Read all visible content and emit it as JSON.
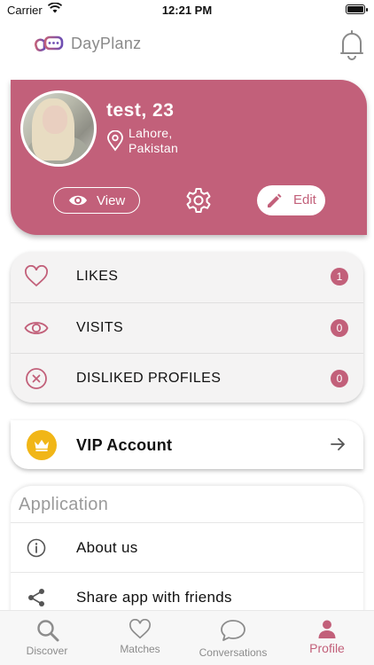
{
  "status_bar": {
    "carrier": "Carrier",
    "time": "12:21 PM"
  },
  "header": {
    "app_name": "DayPlanz",
    "logo_icon": "dayplanz-logo",
    "bell_icon": "bell-icon"
  },
  "profile": {
    "name_age": "test, 23",
    "location_line1": "Lahore,",
    "location_line2": "Pakistan",
    "view_label": "View",
    "edit_label": "Edit"
  },
  "stats": [
    {
      "label": "LIKES",
      "count": "1",
      "icon": "heart-icon"
    },
    {
      "label": "VISITS",
      "count": "0",
      "icon": "eye-icon"
    },
    {
      "label": "DISLIKED PROFILES",
      "count": "0",
      "icon": "close-circle-icon"
    }
  ],
  "vip": {
    "label": "VIP Account",
    "icon": "crown-icon"
  },
  "application": {
    "title": "Application",
    "items": [
      {
        "label": "About us",
        "icon": "info-icon"
      },
      {
        "label": "Share app with friends",
        "icon": "share-icon"
      }
    ]
  },
  "tabs": [
    {
      "label": "Discover",
      "icon": "search-icon",
      "active": false
    },
    {
      "label": "Matches",
      "icon": "heart-icon",
      "active": false
    },
    {
      "label": "Conversations",
      "icon": "chat-icon",
      "active": false
    },
    {
      "label": "Profile",
      "icon": "person-icon",
      "active": true
    }
  ],
  "colors": {
    "accent": "#c2607a",
    "vip_gold": "#f1b617",
    "tab_inactive": "#8c8c8c"
  }
}
